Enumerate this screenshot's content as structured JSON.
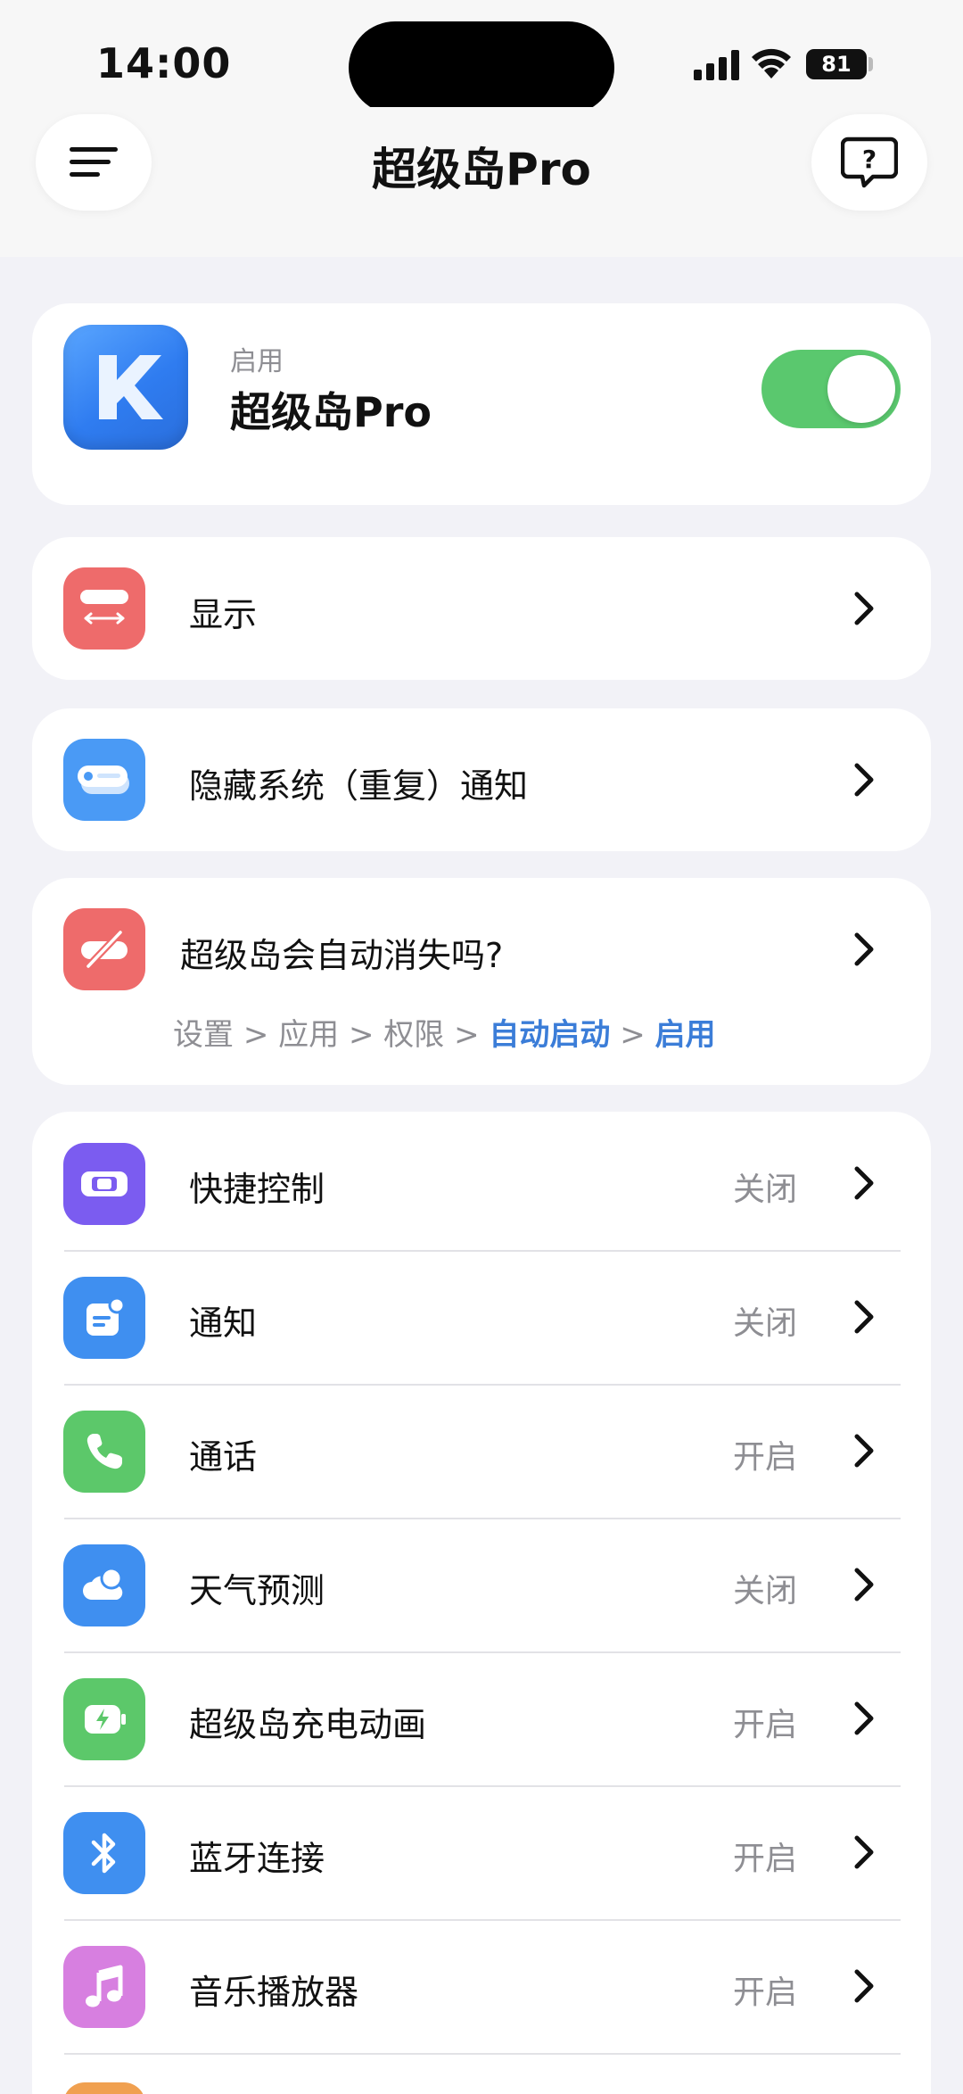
{
  "status_bar": {
    "time": "14:00",
    "battery": "81"
  },
  "nav": {
    "title": "超级岛Pro",
    "menu_icon": "menu-icon",
    "help_icon": "help-icon"
  },
  "app_card": {
    "small_label": "启用",
    "title": "超级岛Pro",
    "enabled": true
  },
  "display": {
    "label": "显示"
  },
  "hide_notify": {
    "label": "隐藏系统（重复）通知"
  },
  "faq": {
    "label": "超级岛会自动消失吗?",
    "path": [
      {
        "text": "设置",
        "highlight": false
      },
      {
        "text": ">",
        "highlight": false
      },
      {
        "text": "应用",
        "highlight": false
      },
      {
        "text": ">",
        "highlight": false
      },
      {
        "text": "权限",
        "highlight": false
      },
      {
        "text": ">",
        "highlight": false
      },
      {
        "text": "自动启动",
        "highlight": true
      },
      {
        "text": ">",
        "highlight": false
      },
      {
        "text": "启用",
        "highlight": true
      }
    ]
  },
  "features": [
    {
      "label": "快捷控制",
      "status": "关闭",
      "icon": "quick-control-icon",
      "color": "#7b5cf0"
    },
    {
      "label": "通知",
      "status": "关闭",
      "icon": "notification-icon",
      "color": "#3f8ff0"
    },
    {
      "label": "通话",
      "status": "开启",
      "icon": "phone-icon",
      "color": "#5cc86a"
    },
    {
      "label": "天气预测",
      "status": "关闭",
      "icon": "weather-icon",
      "color": "#3f8ff0"
    },
    {
      "label": "超级岛充电动画",
      "status": "开启",
      "icon": "charging-icon",
      "color": "#5cc86a"
    },
    {
      "label": "蓝牙连接",
      "status": "开启",
      "icon": "bluetooth-icon",
      "color": "#3f8ff0"
    },
    {
      "label": "音乐播放器",
      "status": "开启",
      "icon": "music-icon",
      "color": "#d77fe0"
    }
  ],
  "colors": {
    "accent_green": "#5ac86e",
    "display_red": "#ee6b6b",
    "hide_blue": "#4a9af5",
    "link_blue": "#3b7dd8"
  }
}
